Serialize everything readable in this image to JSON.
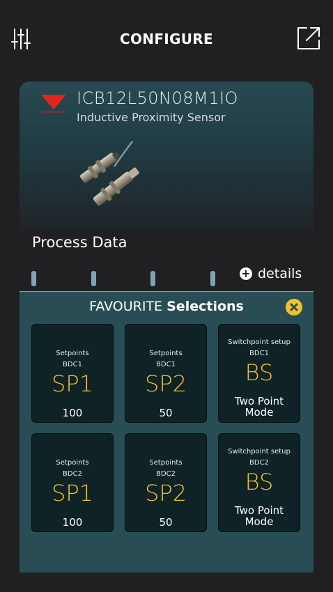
{
  "header": {
    "title": "CONFIGURE",
    "left_icon": "sliders-icon",
    "right_icon": "external-link-icon"
  },
  "device": {
    "brand_logo": "carlo-gavazzi-logo",
    "brand_color": "#e1251b",
    "model": "ICB12L50N08M1IO",
    "type": "Inductive Proximity Sensor"
  },
  "process": {
    "title": "Process Data",
    "details_label": "details",
    "marker_color": "#7ea4b6"
  },
  "favourites": {
    "title_prefix": "FAVOURITE",
    "title_bold": "Selections",
    "accent_color": "#f2c12e",
    "tiles": [
      {
        "caption": "Setpoints",
        "sub": "BDC1",
        "code": "SP1",
        "value": "100"
      },
      {
        "caption": "Setpoints",
        "sub": "BDC1",
        "code": "SP2",
        "value": "50"
      },
      {
        "caption": "Switchpoint setup",
        "sub": "BDC1",
        "code": "BS",
        "mode_line1": "Two Point",
        "mode_line2": "Mode"
      },
      {
        "caption": "Setpoints",
        "sub": "BDC2",
        "code": "SP1",
        "value": "100"
      },
      {
        "caption": "Setpoints",
        "sub": "BDC2",
        "code": "SP2",
        "value": "50"
      },
      {
        "caption": "Switchpoint setup",
        "sub": "BDC2",
        "code": "BS",
        "mode_line1": "Two Point",
        "mode_line2": "Mode"
      }
    ]
  }
}
